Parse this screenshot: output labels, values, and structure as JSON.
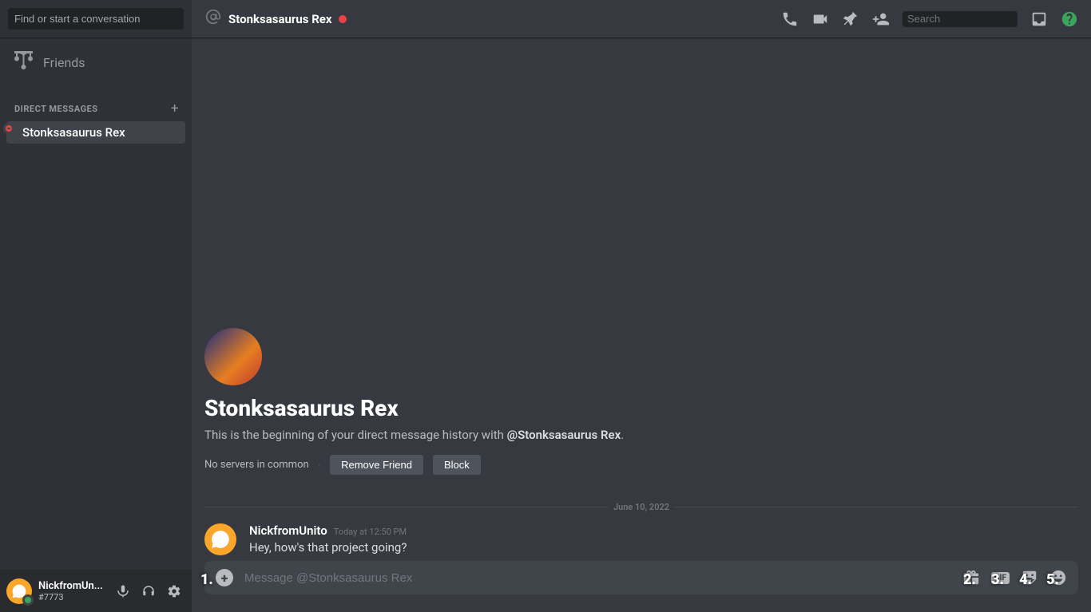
{
  "sidebar": {
    "search_placeholder": "Find or start a conversation",
    "friends_label": "Friends",
    "dm_header": "Direct Messages",
    "dm_item_name": "Stonksasaurus Rex"
  },
  "user_panel": {
    "name": "NickfromUn...",
    "tag": "#7773"
  },
  "titlebar": {
    "name": "Stonksasaurus Rex",
    "search_placeholder": "Search"
  },
  "welcome": {
    "title": "Stonksasaurus Rex",
    "desc_prefix": "This is the beginning of your direct message history with ",
    "desc_mention": "@Stonksasaurus Rex",
    "desc_suffix": ".",
    "no_servers": "No servers in common",
    "remove_friend": "Remove Friend",
    "block": "Block"
  },
  "divider_date": "June 10, 2022",
  "message": {
    "author": "NickfromUnito",
    "time": "Today at 12:50 PM",
    "text": "Hey, how's that project going?"
  },
  "composer": {
    "placeholder": "Message @Stonksasaurus Rex"
  },
  "overlay_numbers": {
    "n1": "1.",
    "n2": "2.",
    "n3": "3.",
    "n4": "4.",
    "n5": "5."
  }
}
